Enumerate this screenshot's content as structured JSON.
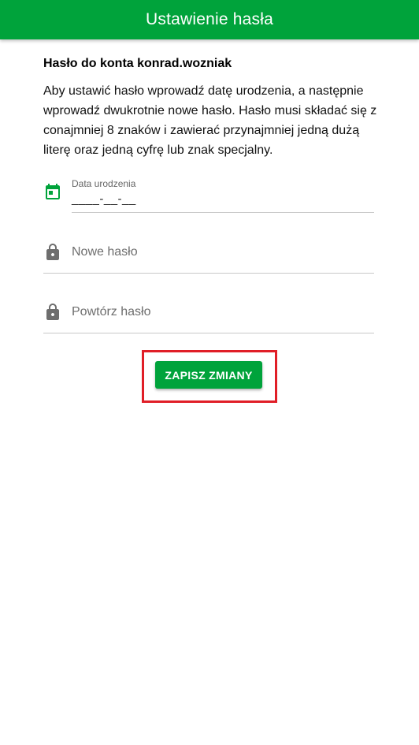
{
  "header": {
    "title": "Ustawienie hasła",
    "background_color": "#00a33b"
  },
  "account": {
    "heading": "Hasło do konta konrad.wozniak"
  },
  "instructions": "Aby ustawić hasło wprowadź datę urodzenia, a następnie wprowadź dwukrotnie nowe hasło. Hasło musi składać się z conajmniej 8 znaków i zawierać przynajmniej jedną dużą literę oraz jedną cyfrę lub znak specjalny.",
  "form": {
    "birth_date": {
      "label": "Data urodzenia",
      "value": "____-__-__",
      "icon": "calendar-icon",
      "icon_color": "#00a33b"
    },
    "new_password": {
      "placeholder": "Nowe hasło",
      "icon": "lock-icon"
    },
    "repeat_password": {
      "placeholder": "Powtórz hasło",
      "icon": "lock-icon"
    }
  },
  "actions": {
    "save_label": "ZAPISZ ZMIANY",
    "save_color": "#00a33b",
    "highlight_color": "#e01e27"
  }
}
